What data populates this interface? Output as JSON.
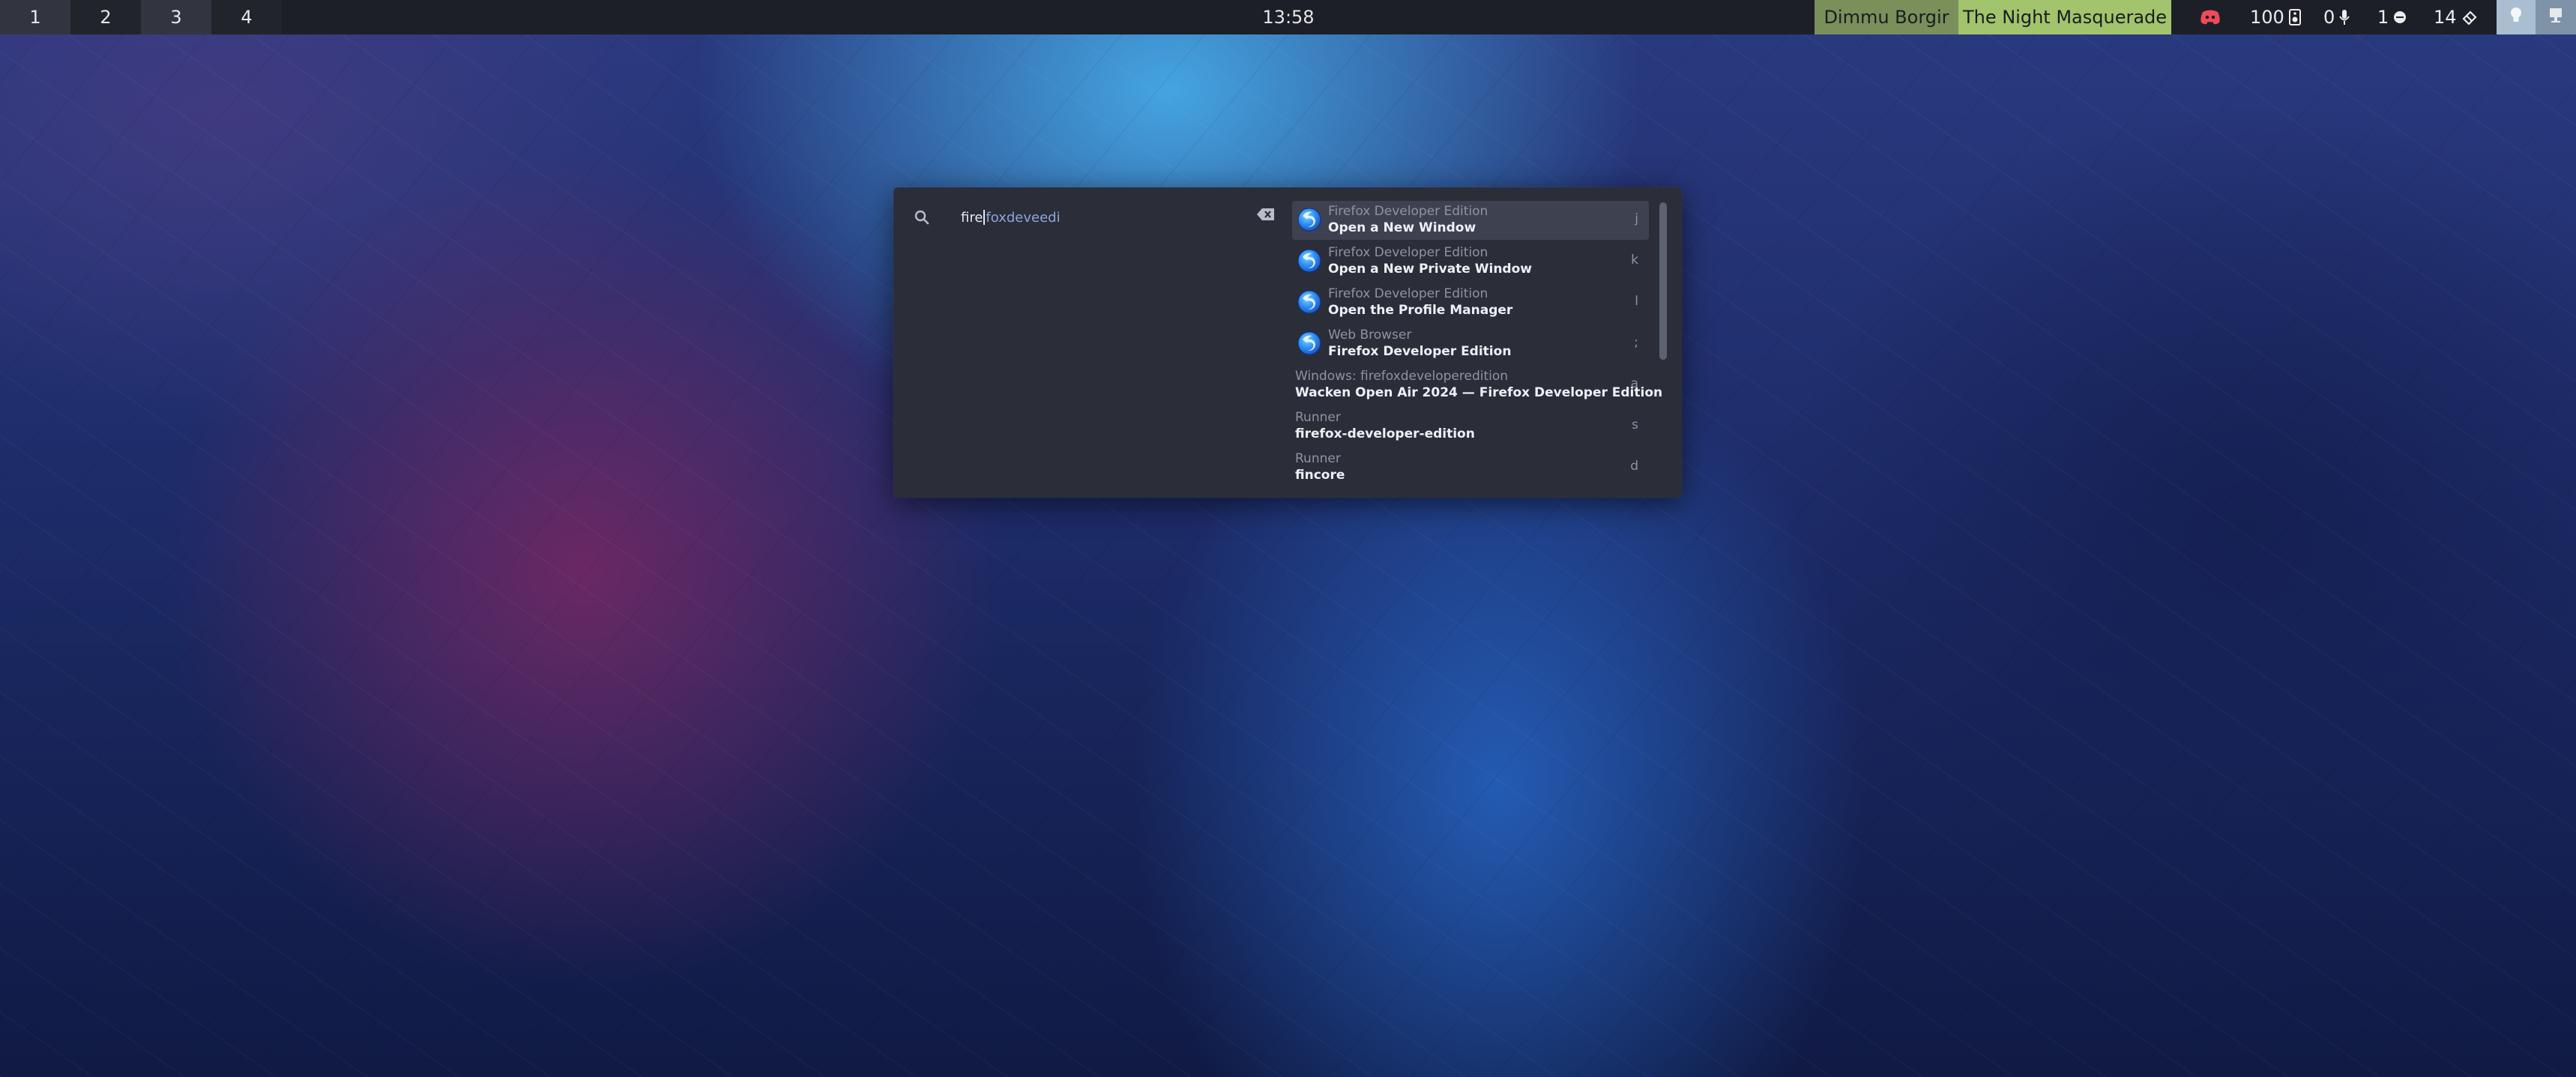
{
  "topbar": {
    "workspaces": [
      "1",
      "2",
      "3",
      "4"
    ],
    "clock": "13:58",
    "media": {
      "artist": "Dimmu Borgir",
      "song": "The Night Masquerade"
    },
    "stats": {
      "volume": "100",
      "mic": "0",
      "notifications": "1",
      "updates": "14"
    },
    "icons": [
      "discord-icon",
      "speaker-icon",
      "microphone-icon",
      "notification-icon",
      "package-icon",
      "lightbulb-icon",
      "power-icon"
    ]
  },
  "launcher": {
    "search": {
      "typed": "fire",
      "suggest": "foxdeveedi"
    },
    "results": [
      {
        "sub": "Firefox Developer Edition",
        "main": "Open a New Window",
        "key": "j",
        "icon": "firefox-icon",
        "selected": true
      },
      {
        "sub": "Firefox Developer Edition",
        "main": "Open a New Private Window",
        "key": "k",
        "icon": "firefox-icon"
      },
      {
        "sub": "Firefox Developer Edition",
        "main": "Open the Profile Manager",
        "key": "l",
        "icon": "firefox-icon"
      },
      {
        "sub": "Web Browser",
        "main": "Firefox Developer Edition",
        "key": ";",
        "icon": "firefox-icon"
      },
      {
        "sub": "Windows: firefoxdeveloperedition",
        "main": "Wacken Open Air 2024 — Firefox Developer Edition",
        "key": "a",
        "icon": ""
      },
      {
        "sub": "Runner",
        "main": "firefox-developer-edition",
        "key": "s",
        "icon": ""
      },
      {
        "sub": "Runner",
        "main": "fincore",
        "key": "d",
        "icon": ""
      }
    ]
  },
  "colors": {
    "bar_bg": "#1d1f28",
    "artist_bg": "#7a8f5a",
    "song_bg": "#a2c46c",
    "launcher_bg": "#2b2e39",
    "selected_bg": "#3e4250",
    "accent": "#8aa6d8"
  }
}
